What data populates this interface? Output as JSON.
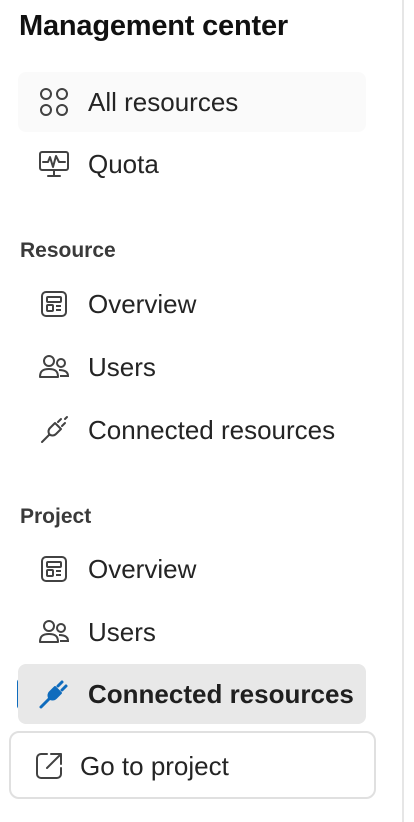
{
  "panel": {
    "title": "Management center"
  },
  "top_items": [
    {
      "label": "All resources",
      "icon": "grid-icon",
      "state": "hovered"
    },
    {
      "label": "Quota",
      "icon": "monitor-pulse-icon"
    }
  ],
  "resource_section": {
    "header": "Resource",
    "items": [
      {
        "label": "Overview",
        "icon": "dashboard-icon"
      },
      {
        "label": "Users",
        "icon": "people-icon"
      },
      {
        "label": "Connected resources",
        "icon": "plug-disconnected-icon"
      }
    ]
  },
  "project_section": {
    "header": "Project",
    "items": [
      {
        "label": "Overview",
        "icon": "dashboard-icon"
      },
      {
        "label": "Users",
        "icon": "people-icon"
      },
      {
        "label": "Connected resources",
        "icon": "plug-connected-icon",
        "state": "selected"
      }
    ]
  },
  "footer_button": {
    "label": "Go to project",
    "icon": "open-arrow-icon"
  },
  "colors": {
    "accent": "#0f6cbd",
    "selected_background": "#e8e8e8",
    "hover_background": "#fafafa",
    "border": "#e0e0e0"
  }
}
